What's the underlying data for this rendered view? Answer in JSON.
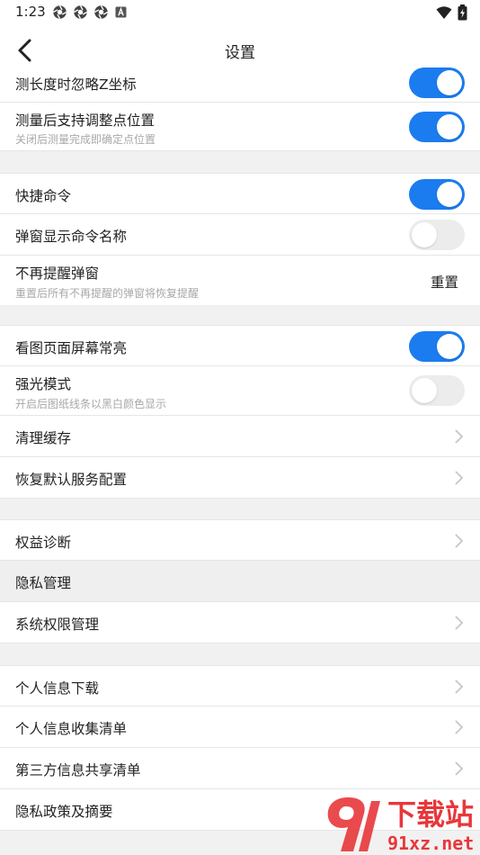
{
  "status_bar": {
    "time": "1:23",
    "left_icons": [
      "aperture-icon",
      "aperture-icon",
      "aperture-icon",
      "a-badge-icon"
    ],
    "right_icons": [
      "wifi-icon",
      "battery-charging-icon"
    ]
  },
  "header": {
    "title": "设置",
    "back_icon": "chevron-left-icon"
  },
  "colors": {
    "accent": "#1b7cf0",
    "toggle_off": "#ececec",
    "page_bg": "#f1f1f1",
    "subtext": "#a8a8a8"
  },
  "rows": {
    "ignore_z": {
      "title": "测长度时忽略Z坐标",
      "toggle": true
    },
    "adjust_points": {
      "title": "测量后支持调整点位置",
      "subtitle": "关闭后测量完成即确定点位置",
      "toggle": true
    },
    "shortcut": {
      "title": "快捷命令",
      "toggle": true
    },
    "popup_name": {
      "title": "弹窗显示命令名称",
      "toggle": false
    },
    "no_remind": {
      "title": "不再提醒弹窗",
      "subtitle": "重置后所有不再提醒的弹窗将恢复提醒",
      "action": "重置"
    },
    "screen_on": {
      "title": "看图页面屏幕常亮",
      "toggle": true
    },
    "strong_light": {
      "title": "强光模式",
      "subtitle": "开启后图纸线条以黑白颜色显示",
      "toggle": false
    },
    "clear_cache": {
      "title": "清理缓存"
    },
    "restore_default": {
      "title": "恢复默认服务配置"
    },
    "rights_diag": {
      "title": "权益诊断"
    },
    "privacy_head": {
      "title": "隐私管理"
    },
    "sys_permissions": {
      "title": "系统权限管理"
    },
    "personal_download": {
      "title": "个人信息下载"
    },
    "personal_collect": {
      "title": "个人信息收集清单"
    },
    "third_party": {
      "title": "第三方信息共享清单"
    },
    "privacy_policy": {
      "title": "隐私政策及摘要"
    }
  },
  "watermark": {
    "text_top": "下载站",
    "text_bottom": "91xz.net"
  }
}
